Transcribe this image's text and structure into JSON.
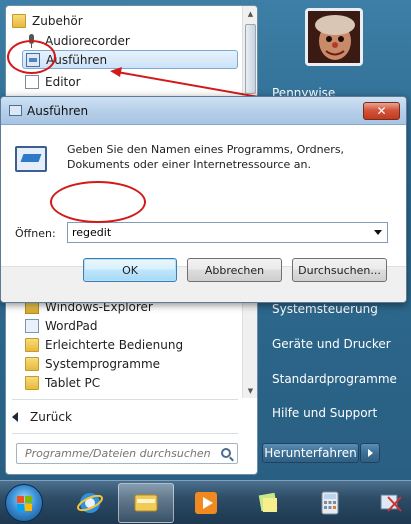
{
  "start_menu": {
    "programs": [
      {
        "label": "Zubehör",
        "icon": "folder-icon"
      },
      {
        "label": "Audiorecorder",
        "icon": "microphone-icon"
      },
      {
        "label": "Ausführen",
        "icon": "run-icon"
      },
      {
        "label": "Editor",
        "icon": "notepad-icon"
      },
      {
        "label": "Windows-Explorer",
        "icon": "explorer-icon"
      },
      {
        "label": "WordPad",
        "icon": "wordpad-icon"
      },
      {
        "label": "Erleichterte Bedienung",
        "icon": "folder-icon"
      },
      {
        "label": "Systemprogramme",
        "icon": "folder-icon"
      },
      {
        "label": "Tablet PC",
        "icon": "folder-icon"
      }
    ],
    "back_label": "Zurück",
    "search_placeholder": "Programme/Dateien durchsuchen",
    "right_items": {
      "user": "Pennywise",
      "control_panel": "Systemsteuerung",
      "devices": "Geräte und Drucker",
      "default_programs": "Standardprogramme",
      "help": "Hilfe und Support"
    },
    "shutdown_label": "Herunterfahren"
  },
  "run_dialog": {
    "title": "Ausführen",
    "close_label": "✕",
    "description": "Geben Sie den Namen eines Programms, Ordners, Dokuments oder einer Internetressource an.",
    "open_label": "Öffnen:",
    "open_value": "regedit",
    "ok_label": "OK",
    "cancel_label": "Abbrechen",
    "browse_label": "Durchsuchen..."
  },
  "annotation_color": "#d31a1a",
  "taskbar": {
    "items": [
      "start-orb",
      "internet-explorer-icon",
      "windows-explorer-icon",
      "media-player-icon",
      "sticky-notes-icon",
      "calculator-icon",
      "snipping-tool-icon"
    ]
  }
}
